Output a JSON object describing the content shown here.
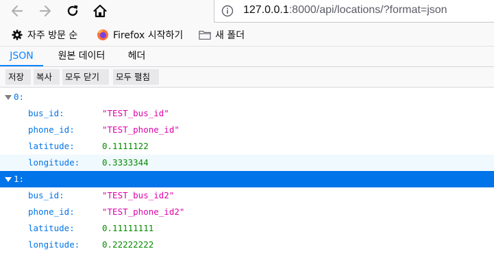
{
  "browser": {
    "url_host": "127.0.0.1",
    "url_rest": ":8000/api/locations/?format=json"
  },
  "bookmarks": [
    {
      "label": "자주 방문 순",
      "icon": "gear-icon"
    },
    {
      "label": "Firefox 시작하기",
      "icon": "firefox-icon"
    },
    {
      "label": "새 폴더",
      "icon": "folder-icon"
    }
  ],
  "viewer": {
    "tabs": [
      "JSON",
      "원본 데이터",
      "헤더"
    ],
    "active_tab": "JSON",
    "toolbar": [
      "저장",
      "복사",
      "모두 닫기",
      "모두 펼침"
    ]
  },
  "json": [
    {
      "index": "0:",
      "fields": [
        {
          "key": "bus_id:",
          "value": "\"TEST_bus_id\"",
          "type": "string"
        },
        {
          "key": "phone_id:",
          "value": "\"TEST_phone_id\"",
          "type": "string"
        },
        {
          "key": "latitude:",
          "value": "0.1111122",
          "type": "number"
        },
        {
          "key": "longitude:",
          "value": "0.3333344",
          "type": "number"
        }
      ]
    },
    {
      "index": "1:",
      "fields": [
        {
          "key": "bus_id:",
          "value": "\"TEST_bus_id2\"",
          "type": "string"
        },
        {
          "key": "phone_id:",
          "value": "\"TEST_phone_id2\"",
          "type": "string"
        },
        {
          "key": "latitude:",
          "value": "0.11111111",
          "type": "number"
        },
        {
          "key": "longitude:",
          "value": "0.22222222",
          "type": "number"
        }
      ]
    }
  ],
  "colors": {
    "accent": "#0a84ff",
    "selected_row": "#0074e8",
    "hover_row": "#f0f9fe",
    "string": "#dd00a9",
    "number": "#058b00",
    "key": "#0074e8"
  }
}
